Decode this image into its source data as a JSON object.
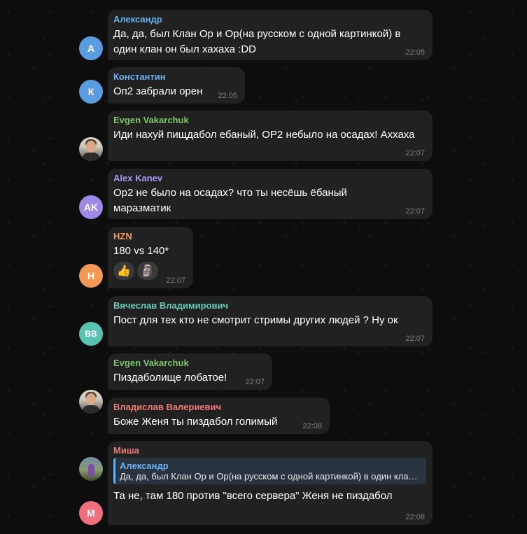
{
  "colors": {
    "bubble": "#212121",
    "time": "#7f7f7f",
    "text": "#ffffff"
  },
  "messages": [
    {
      "sender": "Александр",
      "sender_color": "#6ab2f2",
      "avatar_initials": "А",
      "avatar_color": "#5b9be0",
      "text": "Да, да, был Клан Ор и Ор(на русском с одной картинкой) в один клан он был хахаха :DD",
      "time": "22:05"
    },
    {
      "sender": "Константин",
      "sender_color": "#6ab2f2",
      "avatar_initials": "К",
      "avatar_color": "#5b9be0",
      "text": "Оп2 забрали орен",
      "time": "22:05"
    },
    {
      "sender": "Evgen Vakarchuk",
      "sender_color": "#7fc66b",
      "avatar_icon": "user-photo-icon",
      "text": "Иди нахуй пищдабол ебаный, OP2 небыло на осадах! Аххаха",
      "time": "22:07"
    },
    {
      "sender": "Alex Kanev",
      "sender_color": "#a59bf5",
      "avatar_initials": "AK",
      "avatar_color": "#9d8ae8",
      "text": "Op2 не было на осадах? что ты несёшь ёбаный маразматик",
      "time": "22:07"
    },
    {
      "sender": "HZN",
      "sender_color": "#f09d5c",
      "avatar_initials": "H",
      "avatar_color": "#f29a55",
      "text": "180 vs 140*",
      "time": "22:07",
      "reactions": [
        "👍",
        "🗿"
      ]
    },
    {
      "sender": "Вячеслав Владимирович",
      "sender_color": "#67cdb8",
      "avatar_initials": "ВВ",
      "avatar_color": "#58c3b3",
      "text": "Пост для тех кто не смотрит стримы других людей ? Ну ок",
      "time": "22:07"
    },
    {
      "sender": "Evgen Vakarchuk",
      "sender_color": "#7fc66b",
      "avatar_icon": "user-photo-icon",
      "text": "Пиздаболище лобатое!",
      "time": "22:07"
    },
    {
      "sender": "Владислав Валериевич",
      "sender_color": "#f07a7a",
      "avatar_icon": "user-photo-icon",
      "text": "Боже Женя ты пиздабол голимый",
      "time": "22:08"
    },
    {
      "sender": "Миша",
      "sender_color": "#f07a7a",
      "avatar_initials": "М",
      "avatar_color": "#ef6f7d",
      "reply": {
        "name": "Александр",
        "text": "Да, да, был Клан Ор и Ор(на русском с одной картинкой) в один клан он был хахаха :DD"
      },
      "text": "Та не, там 180 против \"всего сервера\" Женя не пиздабол",
      "time": "22:08"
    }
  ]
}
